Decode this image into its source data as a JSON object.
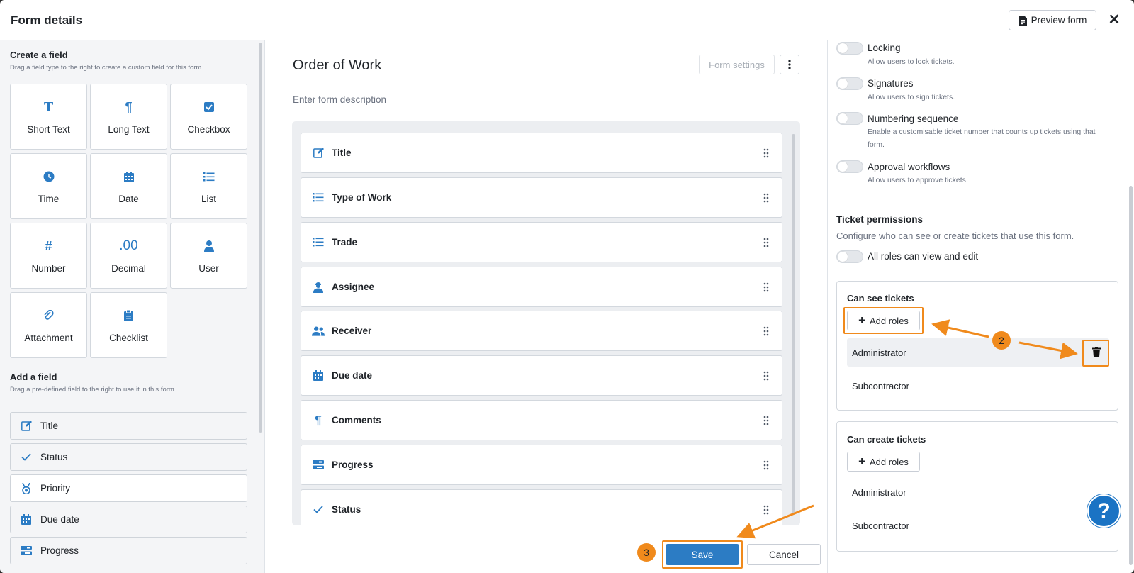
{
  "header": {
    "title": "Form details",
    "preview_label": "Preview form",
    "close_glyph": "✕"
  },
  "left": {
    "create_title": "Create a field",
    "create_desc": "Drag a field type to the right to create a custom field for this form.",
    "types": [
      {
        "label": "Short Text",
        "icon": "T"
      },
      {
        "label": "Long Text",
        "icon": "¶"
      },
      {
        "label": "Checkbox",
        "icon": "checkbox-icon"
      },
      {
        "label": "Time",
        "icon": "clock-icon"
      },
      {
        "label": "Date",
        "icon": "calendar-icon"
      },
      {
        "label": "List",
        "icon": "list-icon"
      },
      {
        "label": "Number",
        "icon": "#"
      },
      {
        "label": "Decimal",
        "icon": ".00"
      },
      {
        "label": "User",
        "icon": "user-icon"
      },
      {
        "label": "Attachment",
        "icon": "paperclip-icon"
      },
      {
        "label": "Checklist",
        "icon": "clipboard-icon"
      }
    ],
    "add_title": "Add a field",
    "add_desc": "Drag a pre-defined field to the right to use it in this form.",
    "predefined": [
      {
        "label": "Title",
        "icon": "edit-icon"
      },
      {
        "label": "Status",
        "icon": "check-icon"
      },
      {
        "label": "Priority",
        "icon": "medal-icon"
      },
      {
        "label": "Due date",
        "icon": "calendar-icon"
      },
      {
        "label": "Progress",
        "icon": "progress-icon"
      }
    ]
  },
  "main": {
    "form_title": "Order of Work",
    "form_desc_placeholder": "Enter form description",
    "form_settings_label": "Form settings",
    "fields": [
      {
        "label": "Title",
        "icon": "edit-icon"
      },
      {
        "label": "Type of Work",
        "icon": "list-icon"
      },
      {
        "label": "Trade",
        "icon": "list-icon"
      },
      {
        "label": "Assignee",
        "icon": "assignee-icon"
      },
      {
        "label": "Receiver",
        "icon": "users-icon"
      },
      {
        "label": "Due date",
        "icon": "calendar-icon"
      },
      {
        "label": "Comments",
        "icon": "paragraph-icon"
      },
      {
        "label": "Progress",
        "icon": "progress-icon"
      },
      {
        "label": "Status",
        "icon": "check-icon"
      }
    ],
    "save_label": "Save",
    "cancel_label": "Cancel"
  },
  "settings": {
    "options": [
      {
        "title": "Locking",
        "desc": "Allow users to lock tickets.",
        "enabled": false
      },
      {
        "title": "Signatures",
        "desc": "Allow users to sign tickets.",
        "enabled": false
      },
      {
        "title": "Numbering sequence",
        "desc": "Enable a customisable ticket number that counts up tickets using that form.",
        "enabled": false
      },
      {
        "title": "Approval workflows",
        "desc": "Allow users to approve tickets",
        "enabled": false
      }
    ],
    "permissions_title": "Ticket permissions",
    "permissions_desc": "Configure who can see or create tickets that use this form.",
    "all_roles_label": "All roles can view and edit",
    "can_see": {
      "title": "Can see tickets",
      "add_label": "Add roles",
      "roles": [
        "Administrator",
        "Subcontractor"
      ]
    },
    "can_create": {
      "title": "Can create tickets",
      "add_label": "Add roles",
      "roles": [
        "Administrator",
        "Subcontractor"
      ]
    }
  },
  "annotations": {
    "step2": "2",
    "step3": "3",
    "accent": "#f08a1c"
  },
  "help_glyph": "?",
  "colors": {
    "primary": "#2c7cc4",
    "help": "#1a73c4"
  }
}
